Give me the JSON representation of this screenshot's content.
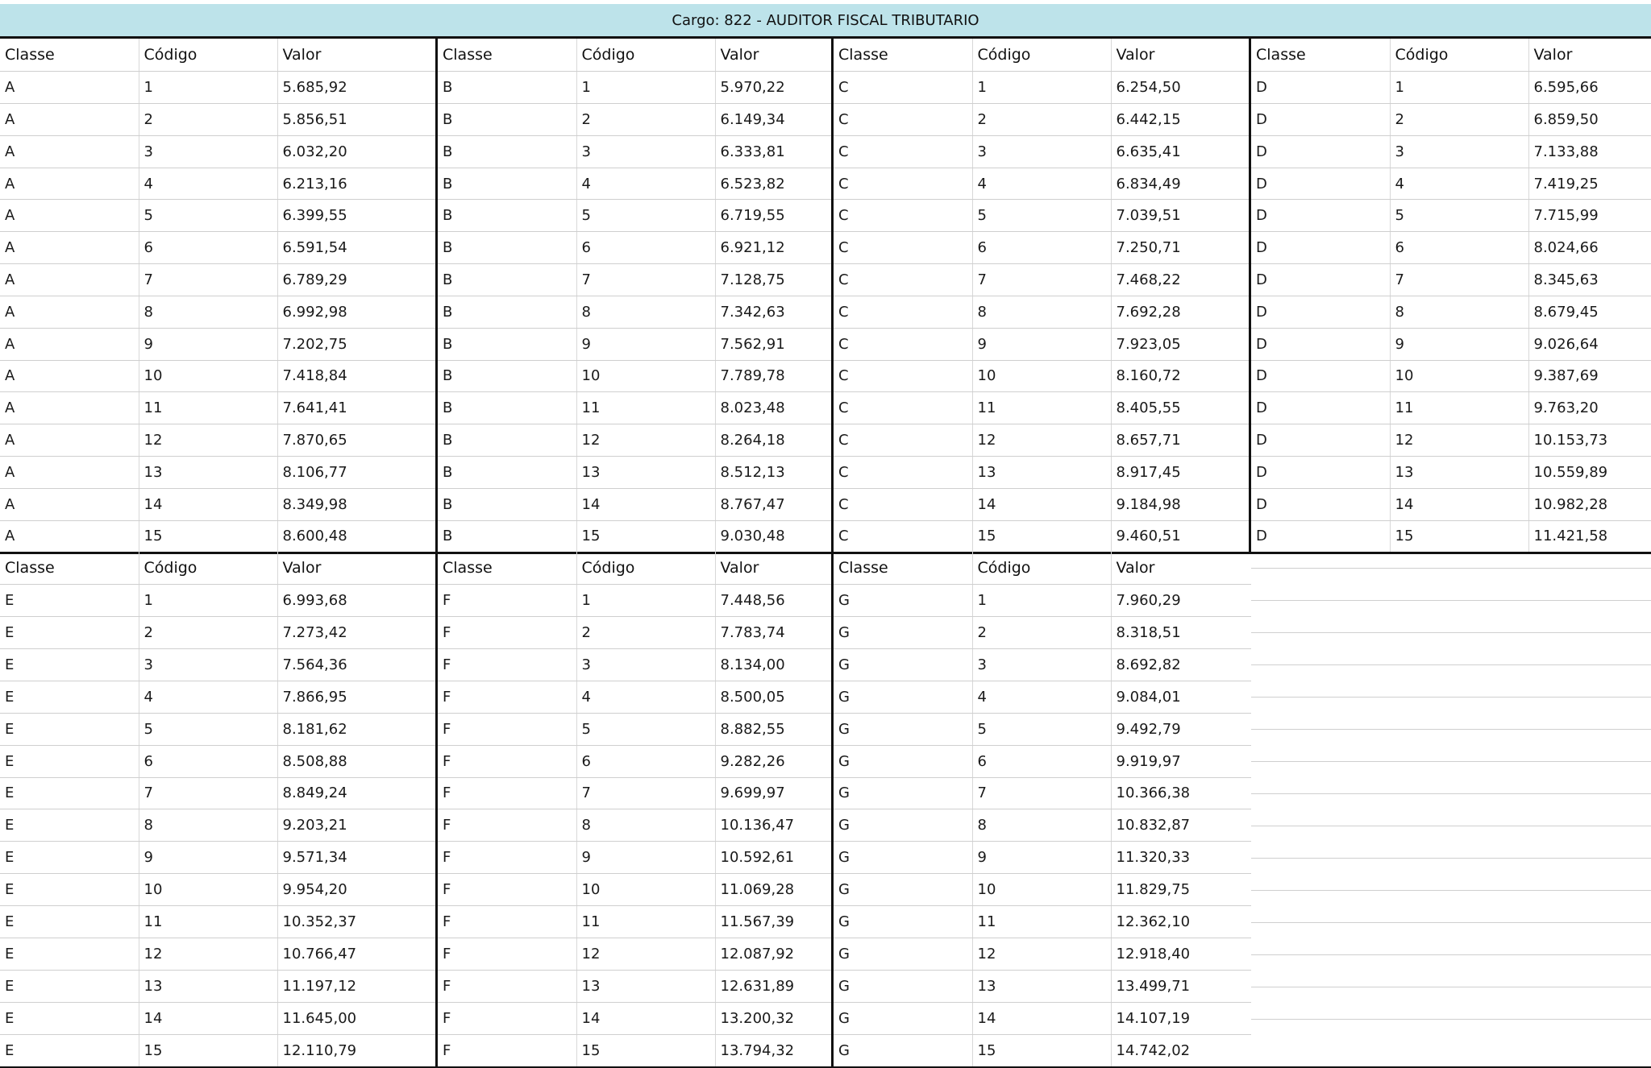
{
  "title": "Cargo: 822 - AUDITOR FISCAL TRIBUTARIO",
  "headers": {
    "classe": "Classe",
    "codigo": "Código",
    "valor": "Valor"
  },
  "groups": [
    {
      "classe": "A",
      "values": [
        "5.685,92",
        "5.856,51",
        "6.032,20",
        "6.213,16",
        "6.399,55",
        "6.591,54",
        "6.789,29",
        "6.992,98",
        "7.202,75",
        "7.418,84",
        "7.641,41",
        "7.870,65",
        "8.106,77",
        "8.349,98",
        "8.600,48"
      ]
    },
    {
      "classe": "B",
      "values": [
        "5.970,22",
        "6.149,34",
        "6.333,81",
        "6.523,82",
        "6.719,55",
        "6.921,12",
        "7.128,75",
        "7.342,63",
        "7.562,91",
        "7.789,78",
        "8.023,48",
        "8.264,18",
        "8.512,13",
        "8.767,47",
        "9.030,48"
      ]
    },
    {
      "classe": "C",
      "values": [
        "6.254,50",
        "6.442,15",
        "6.635,41",
        "6.834,49",
        "7.039,51",
        "7.250,71",
        "7.468,22",
        "7.692,28",
        "7.923,05",
        "8.160,72",
        "8.405,55",
        "8.657,71",
        "8.917,45",
        "9.184,98",
        "9.460,51"
      ]
    },
    {
      "classe": "D",
      "values": [
        "6.595,66",
        "6.859,50",
        "7.133,88",
        "7.419,25",
        "7.715,99",
        "8.024,66",
        "8.345,63",
        "8.679,45",
        "9.026,64",
        "9.387,69",
        "9.763,20",
        "10.153,73",
        "10.559,89",
        "10.982,28",
        "11.421,58"
      ]
    },
    {
      "classe": "E",
      "values": [
        "6.993,68",
        "7.273,42",
        "7.564,36",
        "7.866,95",
        "8.181,62",
        "8.508,88",
        "8.849,24",
        "9.203,21",
        "9.571,34",
        "9.954,20",
        "10.352,37",
        "10.766,47",
        "11.197,12",
        "11.645,00",
        "12.110,79"
      ]
    },
    {
      "classe": "F",
      "values": [
        "7.448,56",
        "7.783,74",
        "8.134,00",
        "8.500,05",
        "8.882,55",
        "9.282,26",
        "9.699,97",
        "10.136,47",
        "10.592,61",
        "11.069,28",
        "11.567,39",
        "12.087,92",
        "12.631,89",
        "13.200,32",
        "13.794,32"
      ]
    },
    {
      "classe": "G",
      "values": [
        "7.960,29",
        "8.318,51",
        "8.692,82",
        "9.084,01",
        "9.492,79",
        "9.919,97",
        "10.366,38",
        "10.832,87",
        "11.320,33",
        "11.829,75",
        "12.362,10",
        "12.918,40",
        "13.499,71",
        "14.107,19",
        "14.742,02"
      ]
    }
  ]
}
